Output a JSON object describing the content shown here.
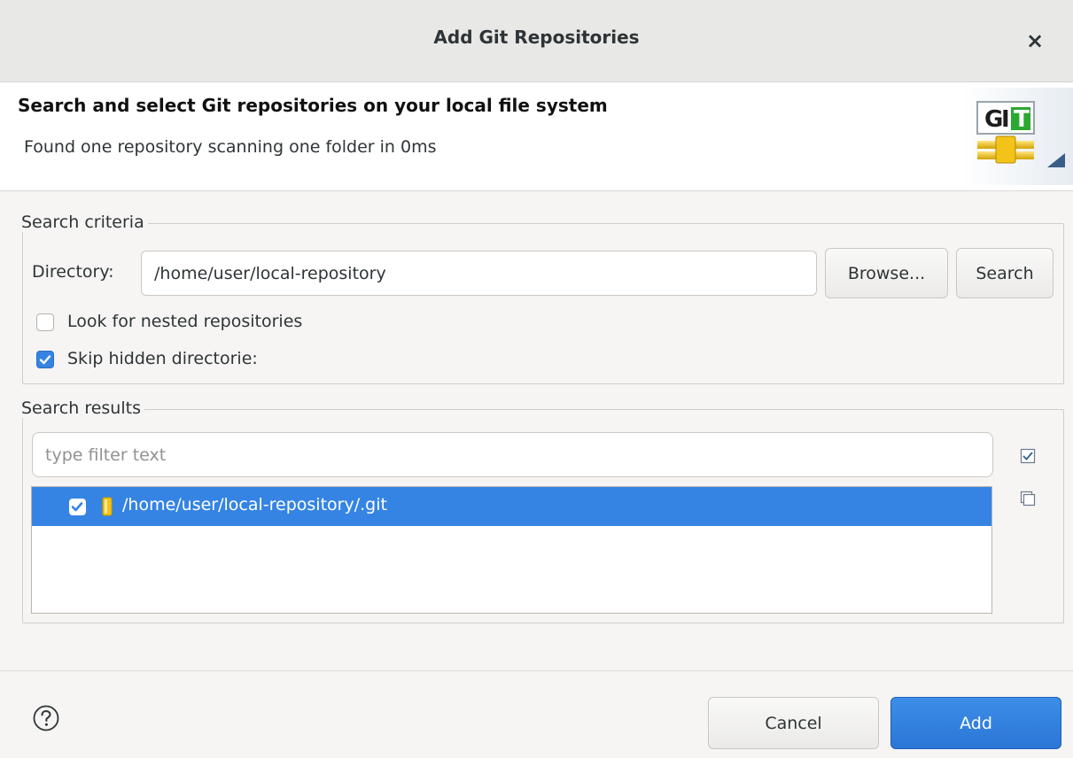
{
  "window": {
    "title": "Add Git Repositories",
    "close_glyph": "×"
  },
  "header": {
    "title": "Search and select Git repositories on your local file system",
    "subtitle": "Found one repository scanning one folder in 0ms",
    "logo_text": "GIT"
  },
  "search_criteria": {
    "legend": "Search criteria",
    "directory_label": "Directory:",
    "directory_value": "/home/user/local-repository",
    "browse_label": "Browse...",
    "search_label": "Search",
    "nested": {
      "label": "Look for nested repositories",
      "checked": false
    },
    "skip_hidden": {
      "label": "Skip hidden directorie:",
      "checked": true
    }
  },
  "search_results": {
    "legend": "Search results",
    "filter_placeholder": "type filter text",
    "select_all_icon": "select-all-icon",
    "deselect_all_icon": "deselect-all-icon",
    "items": [
      {
        "path": "/home/user/local-repository/.git",
        "checked": true,
        "selected": true
      }
    ]
  },
  "footer": {
    "help_icon": "help-icon",
    "cancel_label": "Cancel",
    "add_label": "Add"
  },
  "colors": {
    "accent": "#3584e4",
    "selection": "#3584e4"
  }
}
